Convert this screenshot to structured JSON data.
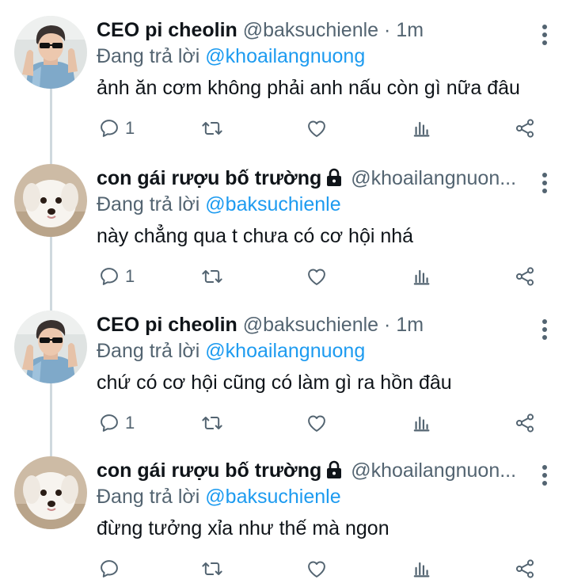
{
  "reply_prefix": "Đang trả lời",
  "tweets": [
    {
      "display_name": "CEO pi cheolin",
      "handle": "@baksuchienle",
      "separator": "·",
      "time": "1m",
      "reply_to": "@khoailangnuong",
      "text": "ảnh ăn cơm không phải anh nấu còn gì nữa đâu",
      "reply_count": "1",
      "avatar": "man-sunglasses"
    },
    {
      "display_name": "con gái rượu bố trường",
      "handle": "@khoailangnuon...",
      "reply_to": "@baksuchienle",
      "text": "này chẳng qua t chưa có cơ hội nhá",
      "reply_count": "1",
      "avatar": "white-dog"
    },
    {
      "display_name": "CEO pi cheolin",
      "handle": "@baksuchienle",
      "separator": "·",
      "time": "1m",
      "reply_to": "@khoailangnuong",
      "text": "chứ có cơ hội cũng có làm gì ra hồn đâu",
      "reply_count": "1",
      "avatar": "man-sunglasses"
    },
    {
      "display_name": "con gái rượu bố trường",
      "handle": "@khoailangnuon...",
      "reply_to": "@baksuchienle",
      "text": "đừng tưởng xỉa như thế mà ngon",
      "reply_count": "",
      "avatar": "white-dog"
    }
  ],
  "icons": {
    "reply": "speech-bubble-icon",
    "retweet": "retweet-arrows-icon",
    "like": "heart-icon",
    "views": "bar-chart-icon",
    "share": "share-icon",
    "more": "vertical-dots-icon",
    "lock": "lock-icon"
  },
  "colors": {
    "link": "#1d9bf0",
    "secondary_text": "#536471",
    "primary_text": "#0f1419",
    "thread_line": "#cfd9de"
  }
}
